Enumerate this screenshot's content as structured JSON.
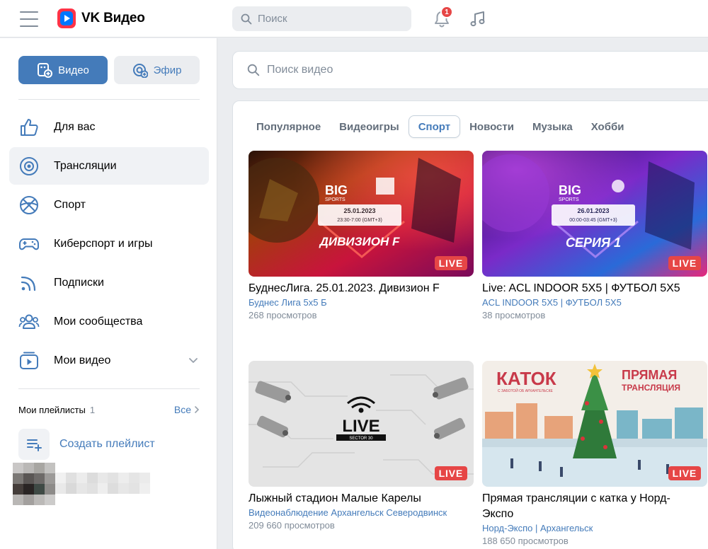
{
  "app": {
    "logo_text": "VK Видео",
    "search_placeholder": "Поиск",
    "notifications_count": "1"
  },
  "sidebar": {
    "mode_video": "Видео",
    "mode_live": "Эфир",
    "nav": [
      {
        "label": "Для вас",
        "icon": "like-icon"
      },
      {
        "label": "Трансляции",
        "icon": "live-circle-icon",
        "active": true
      },
      {
        "label": "Спорт",
        "icon": "ball-icon"
      },
      {
        "label": "Киберспорт и игры",
        "icon": "gamepad-icon"
      },
      {
        "label": "Подписки",
        "icon": "rss-icon"
      },
      {
        "label": "Мои сообщества",
        "icon": "users-icon"
      },
      {
        "label": "Мои видео",
        "icon": "video-icon"
      }
    ],
    "playlists": {
      "title": "Мои плейлисты",
      "count": "1",
      "all_label": "Все",
      "create_label": "Создать плейлист"
    }
  },
  "main": {
    "search_placeholder": "Поиск видео",
    "tabs": [
      "Популярное",
      "Видеоигры",
      "Спорт",
      "Новости",
      "Музыка",
      "Хобби"
    ],
    "active_tab": "Спорт",
    "videos": [
      {
        "title": "БуднесЛига. 25.01.2023. Дивизион F",
        "channel": "Буднес Лига 5х5 Б",
        "views": "268 просмотров",
        "live": "LIVE",
        "thumb": {
          "brand": "BIG",
          "sub": "SPORTS",
          "date": "25.01.2023",
          "time": "23:30-7:00 (GMT+3)",
          "caption": "ДИВИЗИОН F"
        }
      },
      {
        "title": "Live: ACL INDOOR 5X5 | ФУТБОЛ 5Х5",
        "channel": "ACL INDOOR 5X5 | ФУТБОЛ 5Х5",
        "views": "38 просмотров",
        "live": "LIVE",
        "thumb": {
          "brand": "BIG",
          "sub": "SPORTS",
          "date": "26.01.2023",
          "time": "00:00-03:45 (GMT+3)",
          "caption": "СЕРИЯ 1"
        }
      },
      {
        "title": "Лыжный стадион Малые Карелы",
        "channel": "Видеонаблюдение Архангельск Северодвинск",
        "views": "209 660 просмотров",
        "live": "LIVE",
        "thumb": {
          "brand": "LIVE",
          "sub": "SECTOR 30"
        }
      },
      {
        "title_line1": "Прямая трансляции с катка у Норд-",
        "title_line2": "Экспо",
        "channel": "Норд-Экспо | Архангельск",
        "views": "188 650 просмотров",
        "live": "LIVE",
        "thumb": {
          "left": "КАТОК",
          "left_sub": "С ЗАБОТОЙ ОБ АРХАНГЕЛЬСКЕ",
          "right1": "ПРЯМАЯ",
          "right2": "ТРАНСЛЯЦИЯ"
        }
      }
    ]
  },
  "colors": {
    "accent": "#447bba",
    "live": "#e64646",
    "bg": "#ebedf0"
  }
}
